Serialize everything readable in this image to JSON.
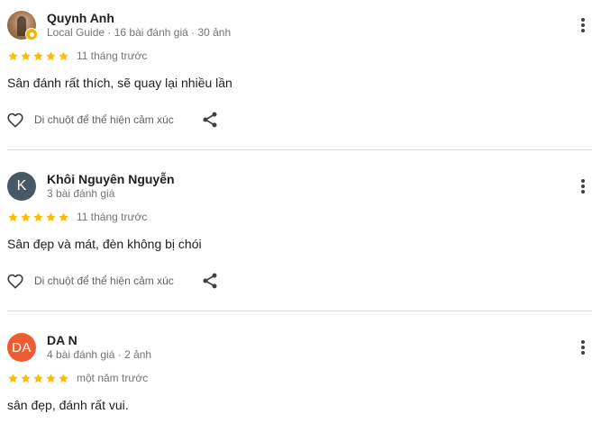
{
  "reviews": [
    {
      "reviewer_name": "Quynh Anh",
      "reviewer_meta": "Local Guide · 16 bài đánh giá · 30 ảnh",
      "avatar_type": "photo",
      "local_guide": true,
      "rating": 5,
      "time": "11 tháng trước",
      "text": "Sân đánh rất thích, sẽ quay lại nhiều lần",
      "react_label": "Di chuột để thể hiện cảm xúc"
    },
    {
      "reviewer_name": "Khôi Nguyên Nguyễn",
      "reviewer_meta": "3 bài đánh giá",
      "avatar_letter": "K",
      "avatar_color": "#455a64",
      "rating": 5,
      "time": "11 tháng trước",
      "text": "Sân đẹp và mát, đèn không bị chói",
      "react_label": "Di chuột để thể hiện cảm xúc"
    },
    {
      "reviewer_name": "DA N",
      "reviewer_meta": "4 bài đánh giá · 2 ảnh",
      "avatar_letter": "DA",
      "avatar_color": "#ef5b32",
      "rating": 5,
      "time": "một năm trước",
      "text": "sân đẹp, đánh rất vui."
    }
  ],
  "icons": {
    "star": "star-icon",
    "more": "more-vert-icon",
    "heart": "heart-outline-icon",
    "share": "share-icon"
  },
  "colors": {
    "star": "#fbbc04",
    "meta_text": "#70757a",
    "divider": "#dadce0"
  }
}
